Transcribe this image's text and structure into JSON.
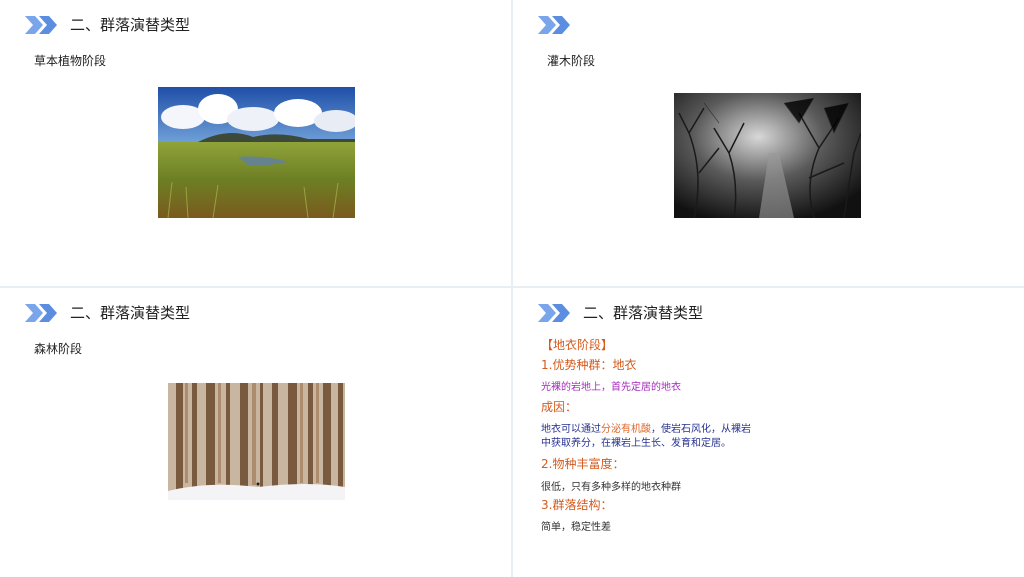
{
  "slides": {
    "s1": {
      "title": "二、群落演替类型",
      "subtitle": "草本植物阶段",
      "image_icon": "grassland-photo"
    },
    "s2": {
      "title": "",
      "subtitle": "灌木阶段",
      "image_icon": "shrubland-bw-photo"
    },
    "s3": {
      "title": "二、群落演替类型",
      "subtitle": "森林阶段",
      "image_icon": "snowy-forest-photo"
    },
    "s4": {
      "title": "二、群落演替类型",
      "stage": "【地衣阶段】",
      "h1": "1.优势种群：地衣",
      "p1": "光裸的岩地上，首先定居的地衣",
      "h2": "成因：",
      "p2a_pre": "地衣可以通过",
      "p2a_hl": "分泌有机酸",
      "p2a_post": "，使岩石风化，从裸岩",
      "p2b": "中获取养分，在裸岩上生长、发育和定居。",
      "h3": "2.物种丰富度：",
      "p3": "很低，只有多种多样的地衣种群",
      "h4": "3.群落结构：",
      "p4": "简单，稳定性差"
    }
  },
  "colors": {
    "chevron": "#6e9be6",
    "heading": "#d45a1d",
    "purple_text": "#a62bbd",
    "navy_text": "#27328f",
    "background": "#e9eef2"
  }
}
